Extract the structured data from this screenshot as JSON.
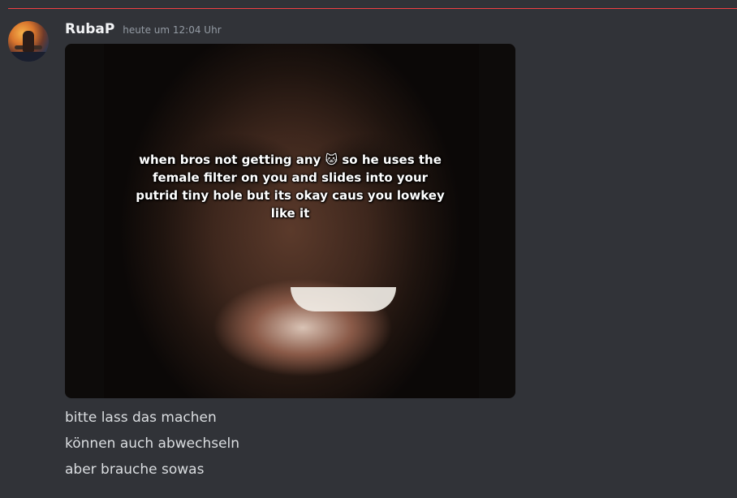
{
  "message": {
    "author": "RubaP",
    "timestamp": "heute um 12:04 Uhr",
    "attachment_caption": "when bros not getting any 🐱 so he uses the female filter on you and slides into your putrid tiny hole but its okay caus you lowkey like it",
    "lines": [
      "bitte lass das machen",
      "können auch abwechseln",
      "aber brauche sowas"
    ]
  },
  "colors": {
    "background": "#313338",
    "divider": "#f23f43",
    "username": "#f2f3f5",
    "timestamp": "#949ba4",
    "text": "#dbdee1"
  }
}
